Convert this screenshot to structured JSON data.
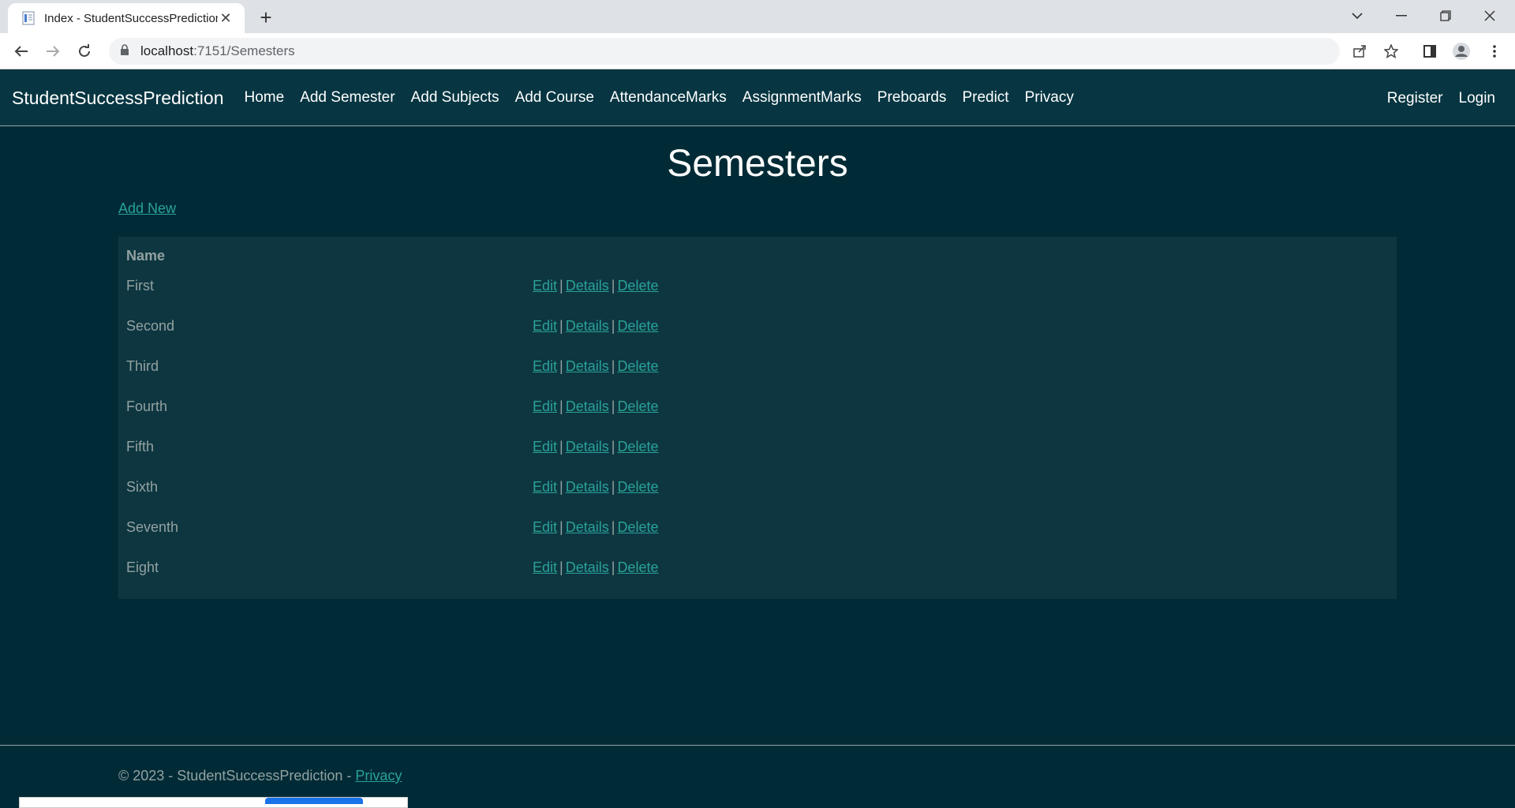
{
  "browser": {
    "tab_title": "Index - StudentSuccessPrediction",
    "url_host": "localhost",
    "url_path": ":7151/Semesters"
  },
  "app": {
    "brand": "StudentSuccessPrediction",
    "nav": [
      "Home",
      "Add Semester",
      "Add Subjects",
      "Add Course",
      "AttendanceMarks",
      "AssignmentMarks",
      "Preboards",
      "Predict",
      "Privacy"
    ],
    "auth": [
      "Register",
      "Login"
    ]
  },
  "page": {
    "title": "Semesters",
    "add_new": "Add New"
  },
  "table": {
    "header": "Name",
    "rows": [
      "First",
      "Second",
      "Third",
      "Fourth",
      "Fifth",
      "Sixth",
      "Seventh",
      "Eight"
    ],
    "actions": [
      "Edit",
      "Details",
      "Delete"
    ],
    "separator": "|"
  },
  "footer": {
    "text": "© 2023 - StudentSuccessPrediction - ",
    "link": "Privacy"
  },
  "colors": {
    "background": "#002b36",
    "navbar": "#073642",
    "link": "#2aa198",
    "text": "#93a1a1"
  }
}
